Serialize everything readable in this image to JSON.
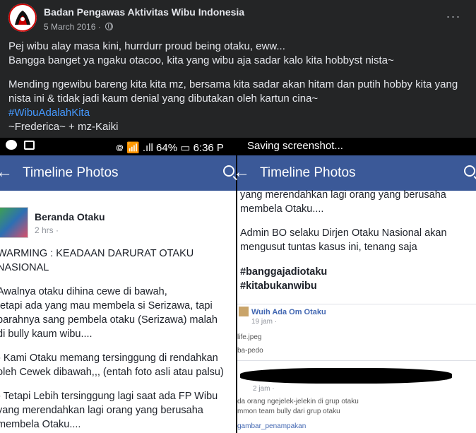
{
  "post": {
    "author": "Badan Pengawas Aktivitas Wibu Indonesia",
    "date": "5 March 2016 ·",
    "more": "···",
    "lines": [
      "Pej wibu alay masa kini, hurrdurr proud being otaku, eww...",
      "Bangga banget ya ngaku otacoo, kita yang wibu aja sadar kalo kita hobbyst nista~",
      "Mending ngewibu bareng kita kita mz, bersama kita sadar akan hitam dan putih hobby kita yang",
      "nista ini & tidak jadi kaum denial yang dibutakan oleh kartun cina~"
    ],
    "hashtag": "#WibuAdalahKita",
    "signature": "~Frederica~ + mz-Kaiki"
  },
  "screenshot": {
    "left": {
      "status": "᪤ 📶 .ıll 64% ▭ 6:36 P",
      "appbar_title": "Timeline Photos",
      "page_name": "Beranda Otaku",
      "page_meta": "2 hrs ·",
      "lines": [
        "WARMING : KEADAAN DARURAT OTAKU",
        "NASIONAL",
        "Awalnya otaku dihina cewe di bawah,",
        "tetapi ada yang mau membela si Serizawa, tapi",
        "parahnya sang pembela otaku (Serizawa) malah",
        "di bully kaum wibu....",
        "- Kami Otaku memang tersinggung di rendahkan",
        "oleh Cewek dibawah,,, (entah foto asli atau palsu)",
        "- Tetapi Lebih tersinggung lagi saat ada FP Wibu",
        "yang merendahkan lagi orang yang berusaha",
        "membela Otaku...."
      ]
    },
    "right": {
      "status": "Saving screenshot...",
      "appbar_title": "Timeline Photos",
      "lines": [
        "yang merendahkan lagi orang yang berusaha",
        "membela Otaku....",
        "Admin BO selaku Dirjen Otaku Nasional akan",
        "mengusut tuntas kasus ini, tenang saja"
      ],
      "tags": [
        "#banggajadiotaku",
        "#kitabukanwibu"
      ],
      "comment1": {
        "name": "Wuih Ada Om Otaku",
        "time": "19 jam ·",
        "line1": "life.jpeg",
        "line2": "ba-pedo"
      },
      "comment2": {
        "time": "2 jam ·",
        "line1": "da orang ngejelek-jelekin di grup otaku",
        "line2": "mmon team bully dari grup otaku",
        "line3": "gambar_penampakan"
      }
    }
  }
}
